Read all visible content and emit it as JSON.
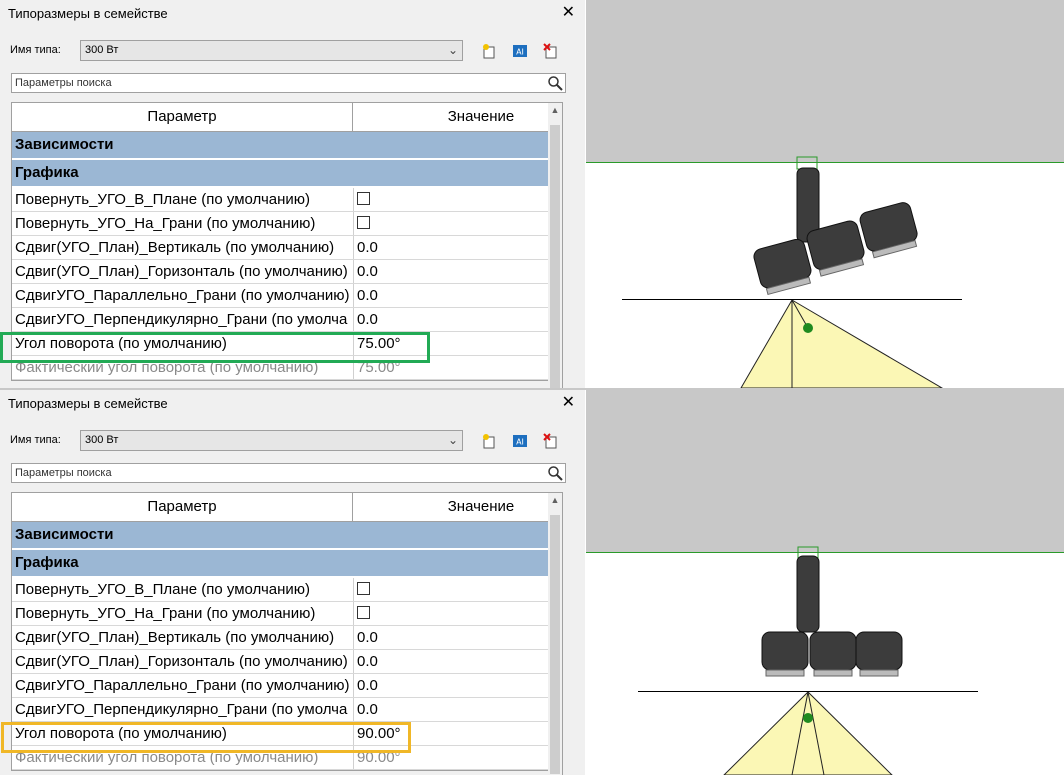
{
  "panels": [
    {
      "title": "Типоразмеры в семействе",
      "type_label": "Имя типа:",
      "type_value": "300 Вт",
      "search_placeholder": "Параметры поиска",
      "header": {
        "param": "Параметр",
        "value": "Значение"
      },
      "group_constraints": "Зависимости",
      "group_graphics": "Графика",
      "rows": [
        {
          "name": "Повернуть_УГО_В_Плане (по умолчанию)",
          "value": ""
        },
        {
          "name": "Повернуть_УГО_На_Грани (по умолчанию)",
          "value": ""
        },
        {
          "name": "Сдвиг(УГО_План)_Вертикаль (по умолчанию)",
          "value": "0.0"
        },
        {
          "name": "Сдвиг(УГО_План)_Горизонталь (по умолчанию)",
          "value": "0.0"
        },
        {
          "name": "СдвигУГО_Параллельно_Грани (по умолчанию)",
          "value": "0.0"
        },
        {
          "name": "СдвигУГО_Перпендикулярно_Грани (по умолча",
          "value": "0.0"
        },
        {
          "name": "Угол поворота (по умолчанию)",
          "value": "75.00°"
        },
        {
          "name": "Фактический угол поворота (по умолчанию)",
          "value": "75.00°"
        }
      ],
      "highlight_color": "#22aa55"
    },
    {
      "title": "Типоразмеры в семействе",
      "type_label": "Имя типа:",
      "type_value": "300 Вт",
      "search_placeholder": "Параметры поиска",
      "header": {
        "param": "Параметр",
        "value": "Значение"
      },
      "group_constraints": "Зависимости",
      "group_graphics": "Графика",
      "rows": [
        {
          "name": "Повернуть_УГО_В_Плане (по умолчанию)",
          "value": ""
        },
        {
          "name": "Повернуть_УГО_На_Грани (по умолчанию)",
          "value": ""
        },
        {
          "name": "Сдвиг(УГО_План)_Вертикаль (по умолчанию)",
          "value": "0.0"
        },
        {
          "name": "Сдвиг(УГО_План)_Горизонталь (по умолчанию)",
          "value": "0.0"
        },
        {
          "name": "СдвигУГО_Параллельно_Грани (по умолчанию)",
          "value": "0.0"
        },
        {
          "name": "СдвигУГО_Перпендикулярно_Грани (по умолча",
          "value": "0.0"
        },
        {
          "name": "Угол поворота (по умолчанию)",
          "value": "90.00°"
        },
        {
          "name": "Фактический угол поворота (по умолчанию)",
          "value": "90.00°"
        }
      ],
      "highlight_color": "#f0b727"
    }
  ],
  "colors": {
    "group_band": "#9bb7d4",
    "light_cone": "#fbf7b5",
    "fixture_body": "#3c3c3c",
    "view_ceiling": "#c8c8c8"
  },
  "icons": [
    "new-type-icon",
    "rename-type-icon",
    "delete-type-icon",
    "search-icon",
    "close-icon",
    "chevron-down-icon"
  ]
}
